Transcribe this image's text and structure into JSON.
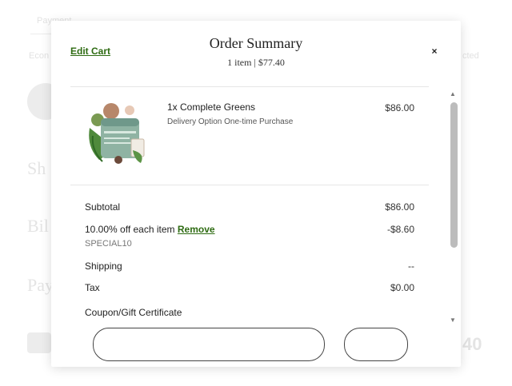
{
  "background": {
    "top_tab": "Payment",
    "left_label_1": "Econ",
    "right_label_1": "cted",
    "heading_1": "Sh",
    "heading_2": "Bil",
    "heading_3": "Pay",
    "total_fragment": "40"
  },
  "modal": {
    "edit_cart_label": "Edit Cart",
    "title": "Order Summary",
    "subtitle": "1 item | $77.40",
    "close_glyph": "×"
  },
  "item": {
    "name": "1x Complete Greens",
    "option": "Delivery Option One-time Purchase",
    "price": "$86.00"
  },
  "summary": {
    "subtotal_label": "Subtotal",
    "subtotal_value": "$86.00",
    "discount_label": "10.00% off each item",
    "remove_label": "Remove",
    "discount_value": "-$8.60",
    "discount_code": "SPECIAL10",
    "shipping_label": "Shipping",
    "shipping_value": "--",
    "tax_label": "Tax",
    "tax_value": "$0.00",
    "coupon_label": "Coupon/Gift Certificate"
  },
  "colors": {
    "accent_green": "#2e6b12",
    "scrollbar": "#bcbcbc"
  },
  "icons": [
    "close-icon",
    "scroll-up-arrow-icon",
    "scroll-down-arrow-icon"
  ]
}
